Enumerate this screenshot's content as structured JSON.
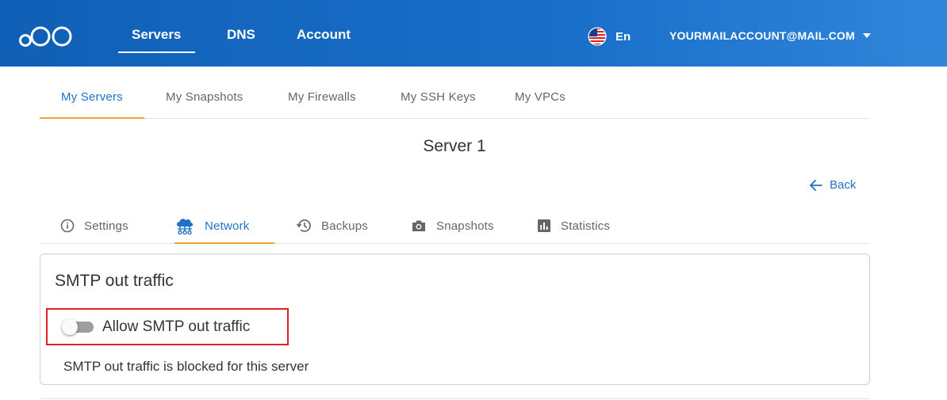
{
  "header": {
    "nav": {
      "servers": "Servers",
      "dns": "DNS",
      "account": "Account"
    },
    "language": "En",
    "account_email": "YOURMAILACCOUNT@MAIL.COM"
  },
  "subtabs": {
    "my_servers": "My Servers",
    "my_snapshots": "My Snapshots",
    "my_firewalls": "My Firewalls",
    "my_ssh_keys": "My SSH Keys",
    "my_vpcs": "My VPCs"
  },
  "server": {
    "title": "Server 1",
    "back_label": "Back"
  },
  "server_tabs": {
    "settings": "Settings",
    "network": "Network",
    "backups": "Backups",
    "snapshots": "Snapshots",
    "statistics": "Statistics"
  },
  "smtp": {
    "title": "SMTP out traffic",
    "toggle_label": "Allow SMTP out traffic",
    "toggle_on": false,
    "status": "SMTP out traffic is blocked for this server"
  },
  "colors": {
    "header": "#1a6fc9",
    "accent": "#1e73c7",
    "tab_underline": "#f0a233",
    "highlight": "#e02020"
  }
}
